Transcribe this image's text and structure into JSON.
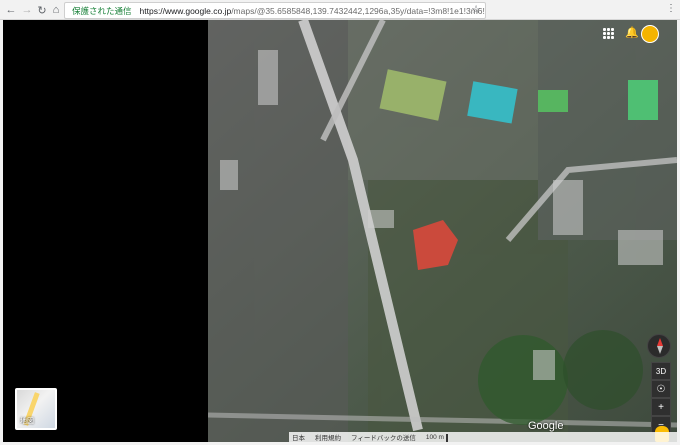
{
  "browser": {
    "secure_label": "保護された通信",
    "url_host": "https://www.google.co.jp",
    "url_path": "/maps/@35.6585848,139.7432442,1296a,35y/data=!3m8!1e1!3m6!···"
  },
  "map": {
    "google_logo": "Google",
    "view_3d": "3D",
    "thumbnail_label": "地図",
    "footer": {
      "region": "日本",
      "terms": "利用規約",
      "feedback": "フィードバックの送信",
      "scale": "100 m"
    }
  },
  "colors": {
    "secure_green": "#188038",
    "map_bg": "#4f5a4c",
    "left_panel": "#000000"
  },
  "icons": {
    "back": "arrow-left-icon",
    "forward": "arrow-right-icon",
    "reload": "reload-icon",
    "home": "home-icon",
    "lock": "lock-icon",
    "star": "star-icon",
    "menu": "more-vert-icon",
    "apps": "apps-grid-icon",
    "notifications": "bell-icon",
    "account": "avatar-icon",
    "compass": "compass-icon",
    "locate": "locate-icon",
    "zoom_in": "plus-icon",
    "zoom_out": "minus-icon",
    "pegman": "pegman-icon"
  }
}
